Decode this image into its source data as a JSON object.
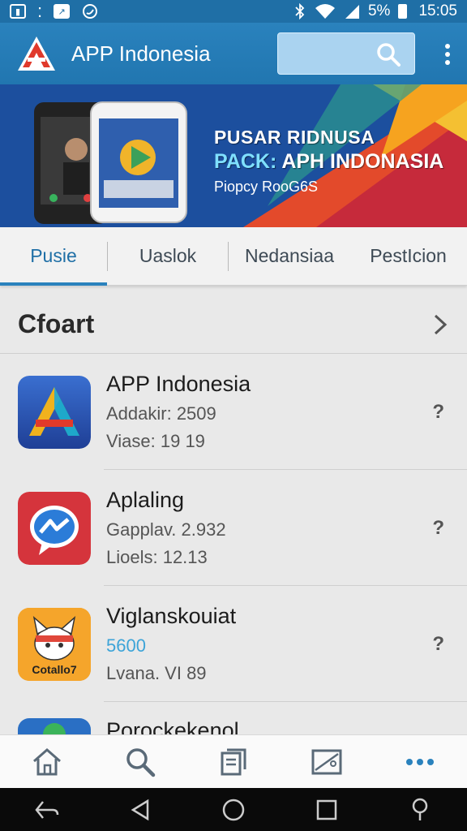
{
  "status_bar": {
    "battery": "5%",
    "time": "15:05",
    "icons": [
      "image-box-icon",
      "chart-icon",
      "whatsapp-icon",
      "bluetooth-icon",
      "wifi-icon",
      "signal-icon",
      "battery-icon"
    ]
  },
  "app_bar": {
    "title": "APP Indonesia",
    "search_placeholder": "",
    "icons": [
      "app-logo",
      "search-icon",
      "overflow-menu-icon"
    ]
  },
  "banner": {
    "line1": "PUSAR RIDNUSA",
    "line2_highlight": "PACK:",
    "line2_rest": " APH INDONASIA",
    "line3": "Piopcy RooG6S"
  },
  "tabs": [
    {
      "label": "Pusie",
      "active": true
    },
    {
      "label": "Uaslok",
      "active": false
    },
    {
      "label": "Nedansiaa",
      "active": false
    },
    {
      "label": "PestIcion",
      "active": false
    }
  ],
  "section": {
    "title": "Cfoart"
  },
  "apps": [
    {
      "name": "APP Indonesia",
      "line1": "Addakir: 2509",
      "line2": "Viase: 19 19",
      "help": "?"
    },
    {
      "name": "Aplaling",
      "line1": "Gapplav. 2.932",
      "line2": "Lioels: 12.13",
      "help": "?"
    },
    {
      "name": "Viglanskouiat",
      "line1": "5600",
      "line2": "Lvana. VI 89",
      "help": "?",
      "icon_text": "Cotallo7"
    },
    {
      "name": "Porockekenol",
      "line1": "",
      "line2": "",
      "help": ""
    }
  ],
  "colors": {
    "primary": "#2176b0",
    "accent_tab": "#2a82bd",
    "link_blue": "#3da4d8"
  }
}
